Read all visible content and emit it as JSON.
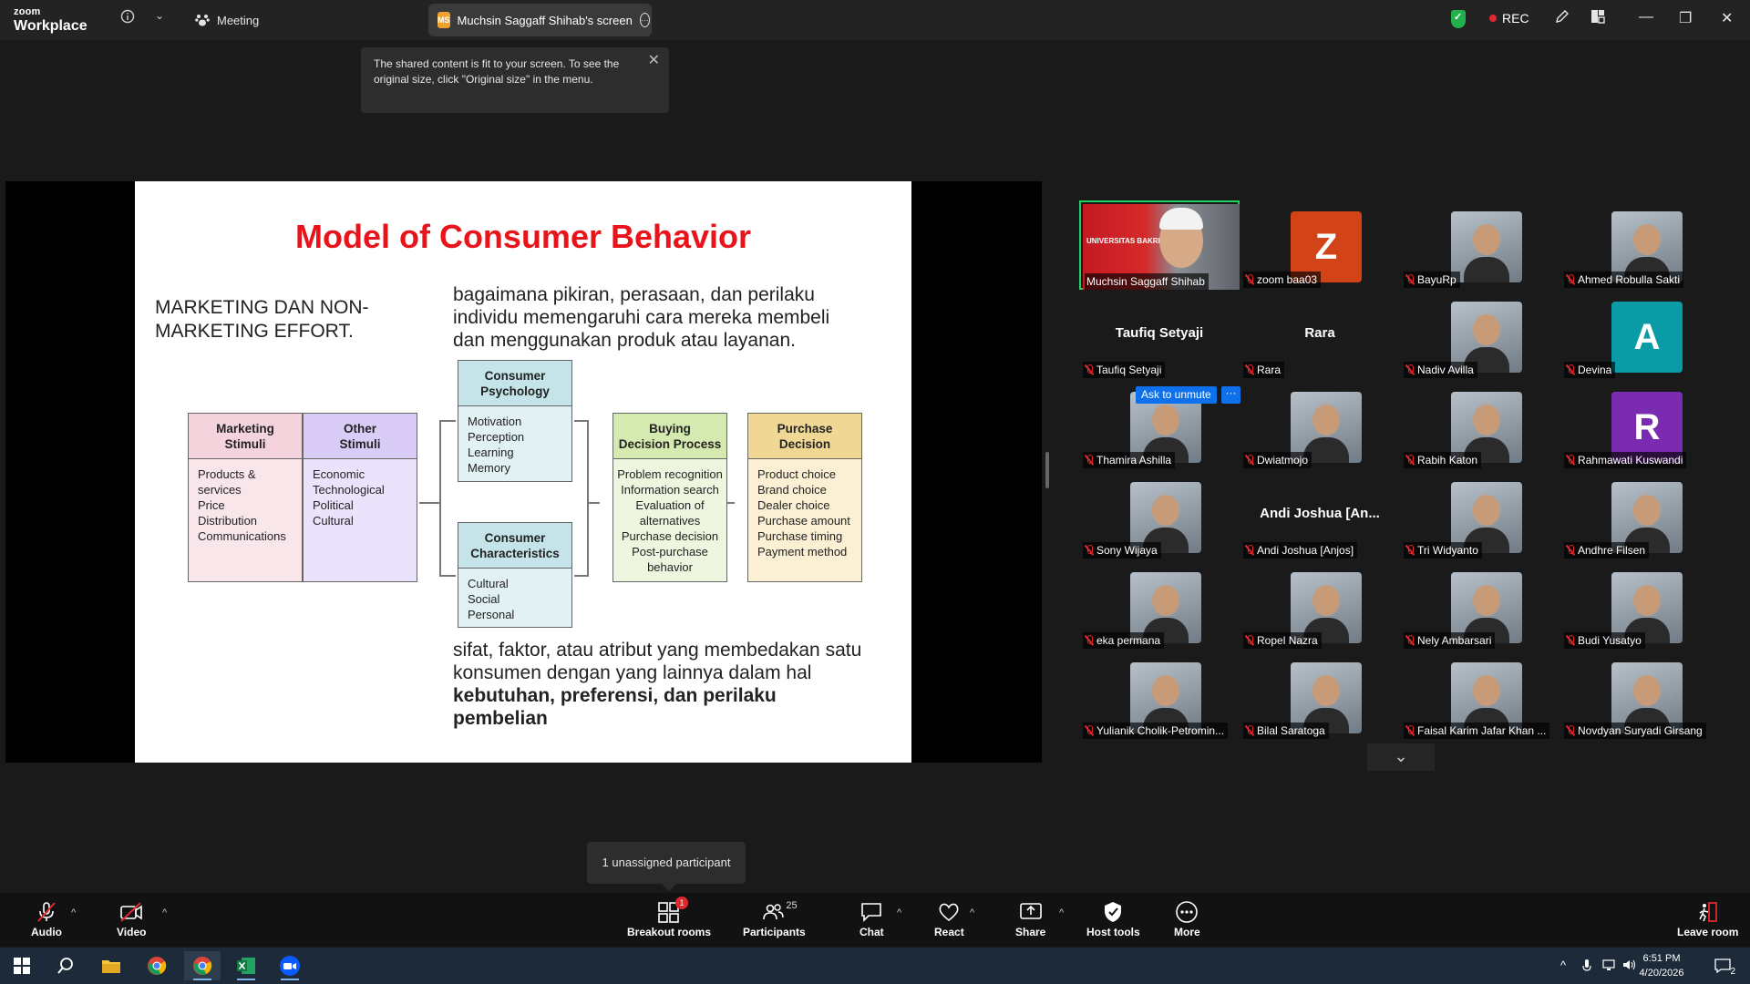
{
  "topbar": {
    "brand_line1": "zoom",
    "brand_line2": "Workplace",
    "meeting_label": "Meeting",
    "share_badge": "MS",
    "share_tab_label": "Muchsin Saggaff Shihab's screen",
    "rec_label": "REC"
  },
  "toast": {
    "text": "The shared content is fit to your screen. To see the original size, click \"Original size\" in the menu."
  },
  "slide": {
    "title": "Model of Consumer Behavior",
    "left_text": "MARKETING DAN NON-MARKETING EFFORT.",
    "right_text": "bagaimana pikiran, perasaan, dan perilaku individu memengaruhi cara mereka membeli dan menggunakan produk atau layanan.",
    "bottom_text_plain": "sifat, faktor, atau atribut yang membedakan satu konsumen dengan yang lainnya dalam hal ",
    "bottom_text_bold": "kebutuhan, preferensi, dan perilaku pembelian",
    "boxes": {
      "marketing": {
        "title1": "Marketing",
        "title2": "Stimuli",
        "body": "Products & services\nPrice\nDistribution\nCommunications"
      },
      "other": {
        "title1": "Other",
        "title2": "Stimuli",
        "body": "Economic\nTechnological\nPolitical\nCultural"
      },
      "psychology": {
        "title1": "Consumer",
        "title2": "Psychology",
        "body": "Motivation\nPerception\nLearning\nMemory"
      },
      "characteristics": {
        "title1": "Consumer",
        "title2": "Characteristics",
        "body": "Cultural\nSocial\nPersonal"
      },
      "buying": {
        "title1": "Buying",
        "title2": "Decision Process",
        "body": "Problem recognition\nInformation search\nEvaluation of\nalternatives\nPurchase decision\nPost-purchase\nbehavior"
      },
      "purchase": {
        "title1": "Purchase",
        "title2": "Decision",
        "body": "Product choice\nBrand choice\nDealer choice\nPurchase amount\nPurchase timing\nPayment method"
      }
    }
  },
  "gallery": {
    "presenter_overlay": "UNIVERSITAS BAKRIE",
    "ask_unmute": "Ask to unmute",
    "ask_more": "···",
    "participants": [
      {
        "name": "Muchsin Saggaff Shihab",
        "type": "presenter"
      },
      {
        "name": "zoom baa03",
        "type": "letter",
        "letter": "Z",
        "color": "#d24317"
      },
      {
        "name": "BayuRp",
        "type": "photo"
      },
      {
        "name": "Ahmed Robulla Sakti",
        "type": "photo"
      },
      {
        "name": "Taufiq Setyaji",
        "type": "name"
      },
      {
        "name": "Rara",
        "type": "name"
      },
      {
        "name": "Nadiv Avilla",
        "type": "photo"
      },
      {
        "name": "Devina",
        "type": "letter",
        "letter": "A",
        "color": "#0b9ba6"
      },
      {
        "name": "Thamira Ashilla",
        "type": "photo"
      },
      {
        "name": "Dwiatmojo",
        "type": "photo"
      },
      {
        "name": "Rabih Katon",
        "type": "photo"
      },
      {
        "name": "Rahmawati Kuswandi",
        "type": "letter",
        "letter": "R",
        "color": "#7a2bb0"
      },
      {
        "name": "Sony Wijaya",
        "type": "photo"
      },
      {
        "name": "Andi Joshua [Anjos]",
        "type": "name",
        "short": "Andi Joshua [An..."
      },
      {
        "name": "Tri Widyanto",
        "type": "photo"
      },
      {
        "name": "Andhre Filsen",
        "type": "photo"
      },
      {
        "name": "eka permana",
        "type": "photo"
      },
      {
        "name": "Ropel Nazra",
        "type": "photo"
      },
      {
        "name": "Nely Ambarsari",
        "type": "photo"
      },
      {
        "name": "Budi Yusatyo",
        "type": "photo"
      },
      {
        "name": "Yulianik Cholik-Petromin...",
        "type": "photo"
      },
      {
        "name": "Bilal Saratoga",
        "type": "photo"
      },
      {
        "name": "Faisal Karim Jafar Khan ...",
        "type": "photo"
      },
      {
        "name": "Novdyan Suryadi Girsang",
        "type": "photo"
      }
    ]
  },
  "breakout_tooltip": "1 unassigned participant",
  "toolbar": {
    "audio": "Audio",
    "video": "Video",
    "breakout": "Breakout rooms",
    "breakout_badge": "1",
    "participants": "Participants",
    "participants_count": "25",
    "chat": "Chat",
    "react": "React",
    "share": "Share",
    "host_tools": "Host tools",
    "more": "More",
    "leave": "Leave room"
  },
  "taskbar": {
    "time": "6:51 PM",
    "date": "4/20/2026",
    "notif_count": "2"
  }
}
